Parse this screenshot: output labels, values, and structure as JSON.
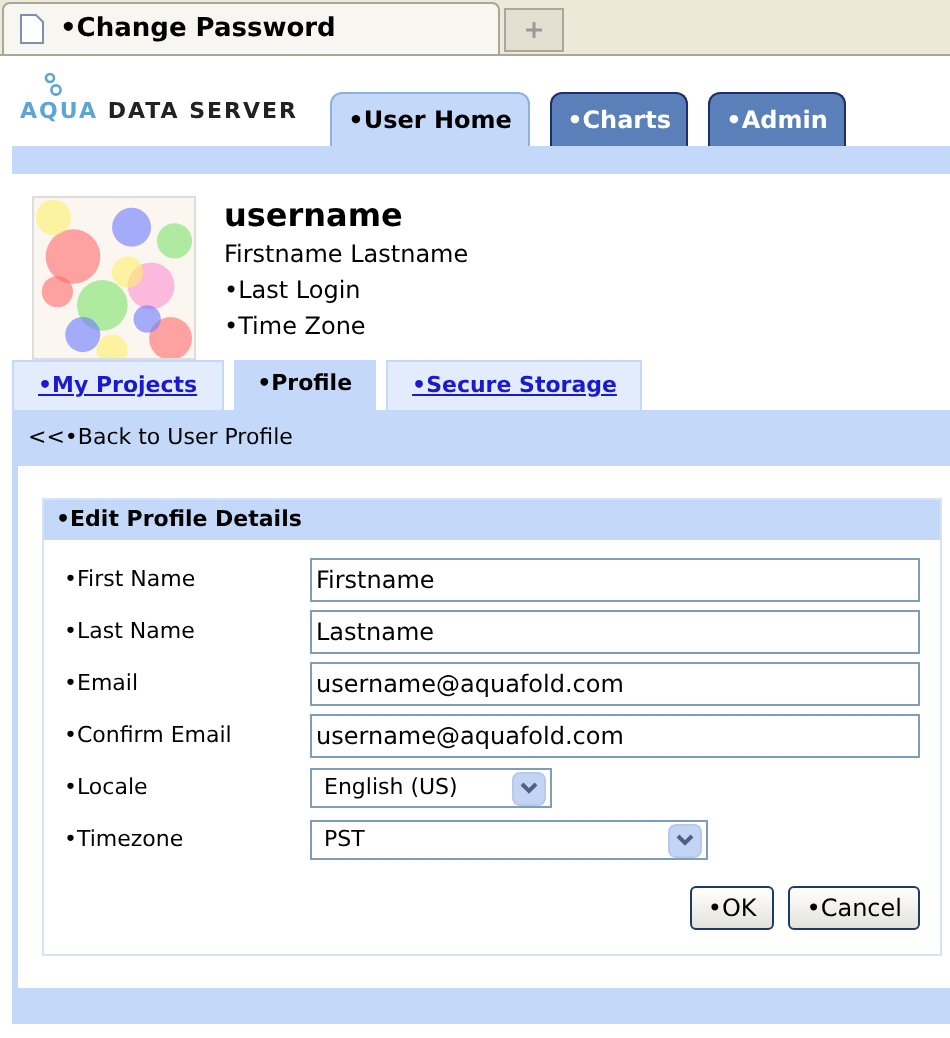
{
  "browser_tab": {
    "title": "•Change Password"
  },
  "logo": {
    "text_accent": "AQUA",
    "text": "DATA SERVER"
  },
  "main_tabs": [
    {
      "label": "•User Home",
      "selected": true
    },
    {
      "label": "•Charts",
      "selected": false
    },
    {
      "label": "•Admin",
      "selected": false
    }
  ],
  "profile": {
    "username": "username",
    "full_name": "Firstname Lastname",
    "lines": [
      "•Last Login",
      "•Time Zone"
    ]
  },
  "sub_tabs": [
    {
      "label": "•My Projects",
      "selected": false
    },
    {
      "label": "•Profile",
      "selected": true
    },
    {
      "label": "•Secure Storage",
      "selected": false
    }
  ],
  "back_link": "<<•Back to User Profile",
  "panel": {
    "title": "•Edit Profile Details",
    "fields": [
      {
        "kind": "text",
        "label": "•First Name",
        "value": "Firstname"
      },
      {
        "kind": "text",
        "label": "•Last Name",
        "value": "Lastname"
      },
      {
        "kind": "text",
        "label": "•Email",
        "value": "username@aquafold.com"
      },
      {
        "kind": "text",
        "label": "•Confirm Email",
        "value": "username@aquafold.com"
      },
      {
        "kind": "select",
        "label": "•Locale",
        "value": "English (US)"
      },
      {
        "kind": "select",
        "label": "•Timezone",
        "value": "PST"
      }
    ],
    "buttons": [
      "•OK",
      "•Cancel"
    ]
  }
}
